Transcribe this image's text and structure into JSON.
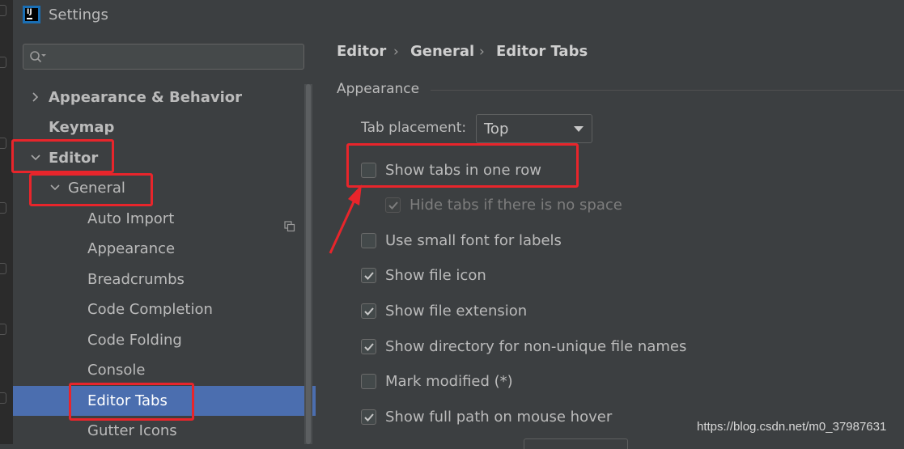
{
  "window": {
    "title": "Settings",
    "logo_text": "IJ"
  },
  "search": {
    "value": "",
    "placeholder": ""
  },
  "tree": {
    "items": [
      {
        "label": "Appearance & Behavior",
        "expanded": false
      },
      {
        "label": "Keymap"
      },
      {
        "label": "Editor",
        "expanded": true
      },
      {
        "label": "General",
        "expanded": true
      },
      {
        "label": "Auto Import"
      },
      {
        "label": "Appearance"
      },
      {
        "label": "Breadcrumbs"
      },
      {
        "label": "Code Completion"
      },
      {
        "label": "Code Folding"
      },
      {
        "label": "Console"
      },
      {
        "label": "Editor Tabs",
        "selected": true
      },
      {
        "label": "Gutter Icons"
      }
    ]
  },
  "breadcrumb": [
    "Editor",
    "General",
    "Editor Tabs"
  ],
  "breadcrumb_separator": "›",
  "section": {
    "title": "Appearance"
  },
  "tab_placement": {
    "label": "Tab placement:",
    "value": "Top"
  },
  "options": [
    {
      "label": "Show tabs in one row",
      "checked": false,
      "enabled": true
    },
    {
      "label": "Hide tabs if there is no space",
      "checked": true,
      "enabled": false
    },
    {
      "label": "Use small font for labels",
      "checked": false,
      "enabled": true
    },
    {
      "label": "Show file icon",
      "checked": true,
      "enabled": true
    },
    {
      "label": "Show file extension",
      "checked": true,
      "enabled": true
    },
    {
      "label": "Show directory for non-unique file names",
      "checked": true,
      "enabled": true
    },
    {
      "label": "Mark modified (*)",
      "checked": false,
      "enabled": true
    },
    {
      "label": "Show full path on mouse hover",
      "checked": true,
      "enabled": true
    }
  ],
  "watermark": "https://blog.csdn.net/m0_37987631",
  "colors": {
    "background": "#3c3f41",
    "selection": "#4b6eaf",
    "annotation": "#e8252b",
    "text": "#bbbbbb"
  }
}
